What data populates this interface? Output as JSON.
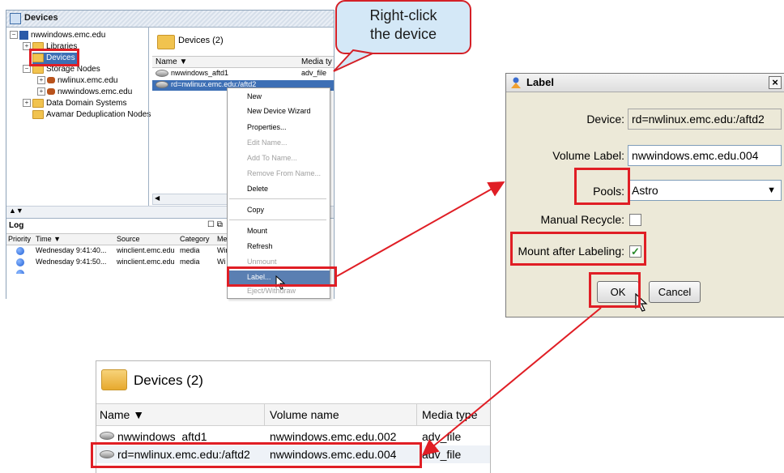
{
  "main_window": {
    "title": "Devices",
    "tree": [
      {
        "label": "nwwindows.emc.edu",
        "icon": "server-icon"
      },
      {
        "label": "Libraries",
        "icon": "folder-icon"
      },
      {
        "label": "Devices",
        "icon": "folder-icon"
      },
      {
        "label": "Storage Nodes",
        "icon": "folder-icon"
      },
      {
        "label": "nwlinux.emc.edu",
        "icon": "server-icon"
      },
      {
        "label": "nwwindows.emc.edu",
        "icon": "server-icon"
      },
      {
        "label": "Data Domain Systems",
        "icon": "folder-icon"
      },
      {
        "label": "Avamar Deduplication Nodes",
        "icon": "folder-icon"
      }
    ],
    "devices_header": "Devices (2)",
    "columns": {
      "name": "Name ▼",
      "media": "Media ty"
    },
    "rows": [
      {
        "name": "nwwindows_aftd1",
        "media": "adv_file"
      },
      {
        "name": "rd=nwlinux.emc.edu:/aftd2",
        "media": "adv_file"
      }
    ],
    "log": {
      "title": "Log",
      "columns": [
        "Priority",
        "Time ▼",
        "Source",
        "Category",
        "Mes"
      ],
      "rows": [
        {
          "time": "Wednesday 9:41:40...",
          "source": "winclient.emc.edu",
          "category": "media",
          "msg": "Win"
        },
        {
          "time": "Wednesday 9:41:50...",
          "source": "winclient.emc.edu",
          "category": "media",
          "msg": "Wi"
        }
      ]
    }
  },
  "context_menu": {
    "items": [
      {
        "label": "New",
        "disabled": false
      },
      {
        "label": "New Device Wizard",
        "disabled": false
      },
      {
        "label": "Properties...",
        "disabled": false
      },
      {
        "label": "Edit Name...",
        "disabled": true
      },
      {
        "label": "Add To Name...",
        "disabled": true
      },
      {
        "label": "Remove From Name...",
        "disabled": true
      },
      {
        "label": "Delete",
        "disabled": false
      },
      {
        "label": "Copy",
        "disabled": false
      },
      {
        "label": "Mount",
        "disabled": false
      },
      {
        "label": "Refresh",
        "disabled": false
      },
      {
        "label": "Unmount",
        "disabled": true
      },
      {
        "label": "Label...",
        "disabled": false
      },
      {
        "label": "Eject/Withdraw",
        "disabled": true
      }
    ]
  },
  "callout": {
    "line1": "Right-click",
    "line2": "the device"
  },
  "label_dialog": {
    "title": "Label",
    "device_label": "Device:",
    "device_value": "rd=nwlinux.emc.edu:/aftd2",
    "volume_label": "Volume Label:",
    "volume_value": "nwwindows.emc.edu.004",
    "pools_label": "Pools:",
    "pools_value": "Astro",
    "manual_recycle_label": "Manual Recycle:",
    "manual_recycle_checked": false,
    "mount_after_label": "Mount after Labeling:",
    "mount_after_checked": true,
    "ok_label": "OK",
    "cancel_label": "Cancel"
  },
  "result_panel": {
    "title": "Devices (2)",
    "columns": {
      "name": "Name ▼",
      "volume": "Volume name",
      "media": "Media type"
    },
    "rows": [
      {
        "name": "nwwindows_aftd1",
        "volume": "nwwindows.emc.edu.002",
        "media": "adv_file"
      },
      {
        "name": "rd=nwlinux.emc.edu:/aftd2",
        "volume": "nwwindows.emc.edu.004",
        "media": "adv_file"
      }
    ]
  },
  "colors": {
    "highlight": "#e01e25",
    "callout_bg": "#d4e8f7",
    "menu_highlight": "#5a7fb2"
  }
}
